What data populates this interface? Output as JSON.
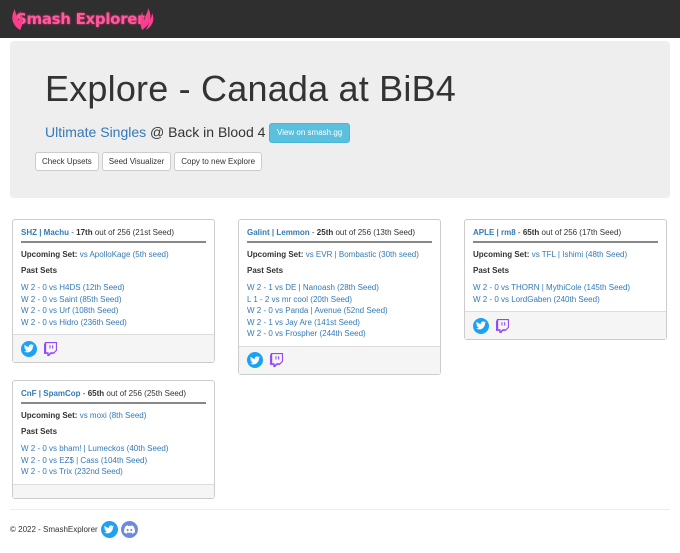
{
  "app": {
    "brand": "Smash Explorer",
    "colors": {
      "navbar": "#2f2f2f",
      "brand_pink": "#ff5aa0",
      "link": "#337ab7",
      "info_button": "#5bc0de",
      "twitter": "#1da1f2",
      "twitch": "#9146ff",
      "discord": "#7289da"
    }
  },
  "header": {
    "title": "Explore - Canada at BiB4",
    "event_link": "Ultimate Singles",
    "at_text": "@ Back in Blood 4",
    "view_button": "View on smash.gg",
    "actions": [
      "Check Upsets",
      "Seed Visualizer",
      "Copy to new Explore"
    ]
  },
  "players": [
    {
      "name": "SHZ | Machu",
      "placement": "17th",
      "of_text": "out of 256 (21st Seed)",
      "upcoming_label": "Upcoming Set:",
      "upcoming": "vs ApolloKage (5th seed)",
      "past_label": "Past Sets",
      "sets": [
        "W 2 - 0 vs H4DS (12th Seed)",
        "W 2 - 0 vs Saint (85th Seed)",
        "W 2 - 0 vs Urf (108th Seed)",
        "W 2 - 0 vs Hidro (236th Seed)"
      ],
      "icons": [
        "twitter-icon",
        "twitch-icon"
      ]
    },
    {
      "name": "Galint | Lemmon",
      "placement": "25th",
      "of_text": "out of 256 (13th Seed)",
      "upcoming_label": "Upcoming Set:",
      "upcoming": "vs EVR | Bombastic (30th seed)",
      "past_label": "Past Sets",
      "sets": [
        "W 2 - 1 vs DE | Nanoash (28th Seed)",
        "L 1 - 2 vs mr cool (20th Seed)",
        "W 2 - 0 vs Panda | Avenue (52nd Seed)",
        "W 2 - 1 vs Jay Are (141st Seed)",
        "W 2 - 0 vs Frospher (244th Seed)"
      ],
      "icons": [
        "twitter-icon",
        "twitch-icon"
      ]
    },
    {
      "name": "APLE | rm8",
      "placement": "65th",
      "of_text": "out of 256 (17th Seed)",
      "upcoming_label": "Upcoming Set:",
      "upcoming": "vs TFL | Ishimi (48th Seed)",
      "past_label": "Past Sets",
      "sets": [
        "W 2 - 0 vs THORN | MythiCole (145th Seed)",
        "W 2 - 0 vs LordGaben (240th Seed)"
      ],
      "icons": [
        "twitter-icon",
        "twitch-icon"
      ]
    },
    {
      "name": "CnF | SpamCop",
      "placement": "65th",
      "of_text": "out of 256 (25th Seed)",
      "upcoming_label": "Upcoming Set:",
      "upcoming": "vs moxi (8th Seed)",
      "past_label": "Past Sets",
      "sets": [
        "W 2 - 0 vs bham! | Lumeckos (40th Seed)",
        "W 2 - 0 vs EZ$ | Cass (104th Seed)",
        "W 2 - 0 vs Trix (232nd Seed)"
      ],
      "icons": []
    }
  ],
  "footer": {
    "copyright": "© 2022 - SmashExplorer"
  }
}
